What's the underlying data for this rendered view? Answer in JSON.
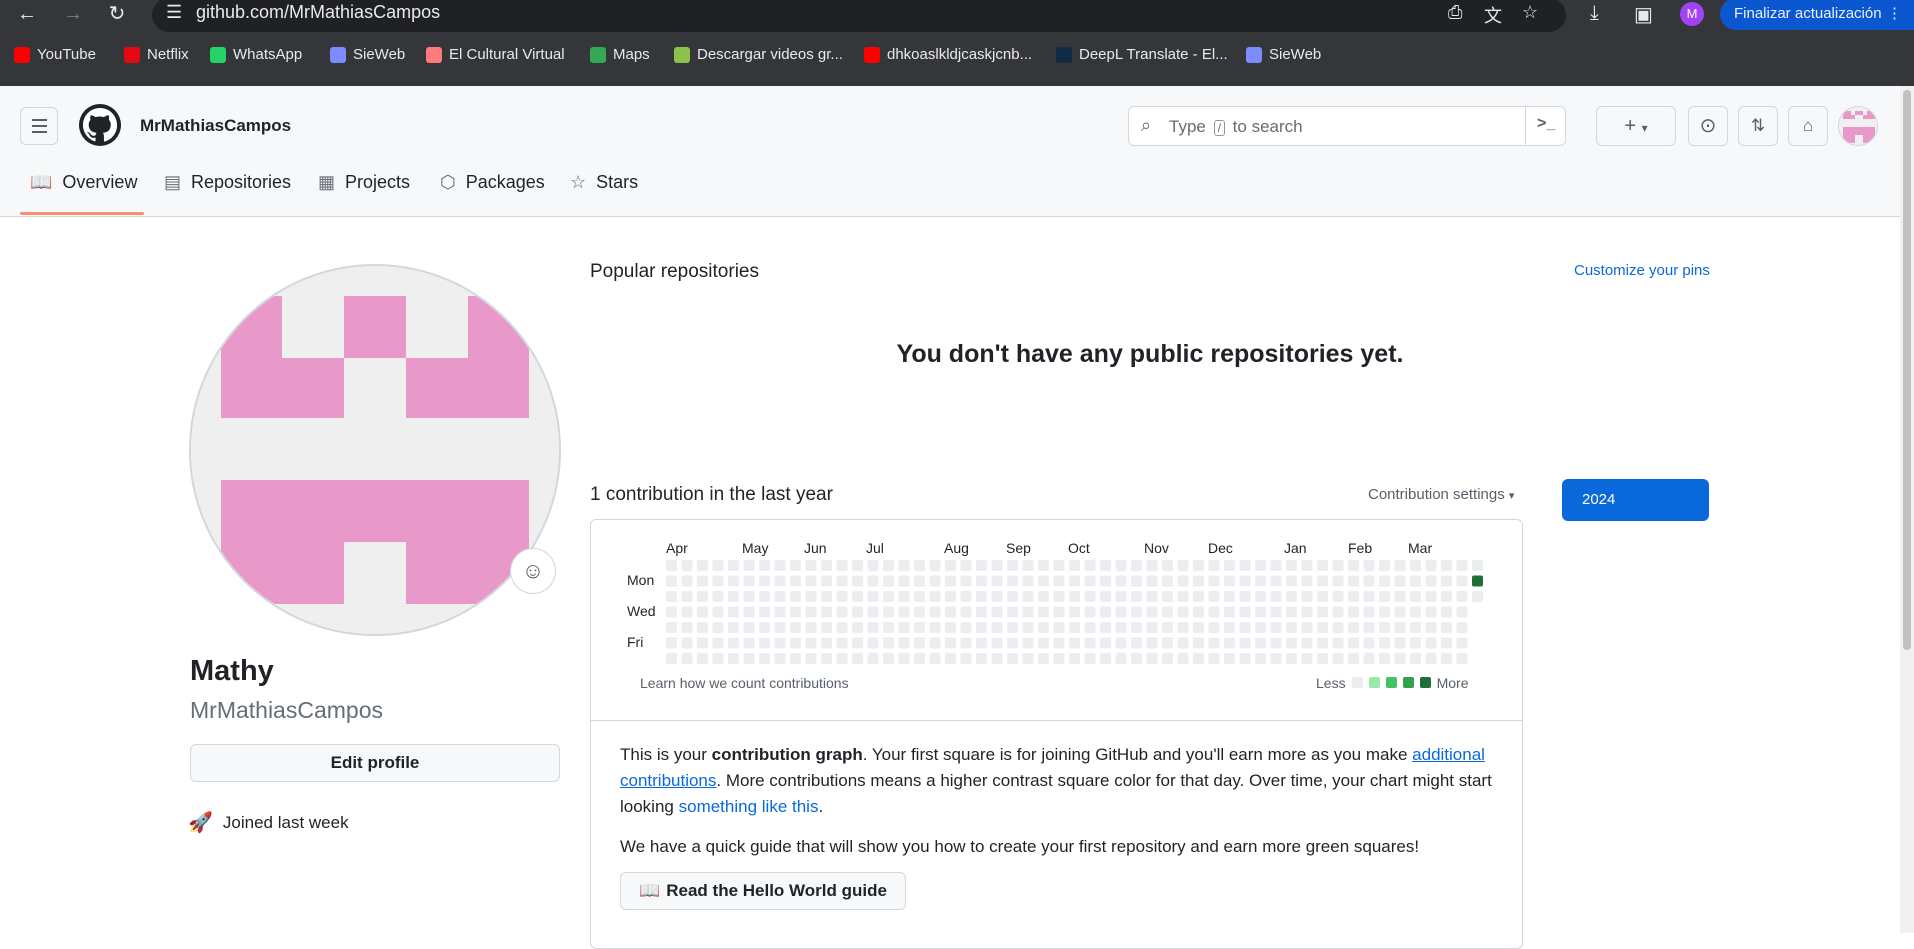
{
  "browser": {
    "url": "github.com/MrMathiasCampos",
    "profile_initial": "M",
    "update_label": "Finalizar actualización",
    "bookmarks": [
      {
        "label": "YouTube",
        "icon": "youtube-icon",
        "color": "#ff0000"
      },
      {
        "label": "Netflix",
        "icon": "netflix-icon",
        "color": "#e50914"
      },
      {
        "label": "WhatsApp",
        "icon": "whatsapp-icon",
        "color": "#25d366"
      },
      {
        "label": "SieWeb",
        "icon": "sieweb-icon",
        "color": "#7b8cff"
      },
      {
        "label": "El Cultural Virtual",
        "icon": "cultural-icon",
        "color": "#ff7a7a"
      },
      {
        "label": "Maps",
        "icon": "maps-icon",
        "color": "#34a853"
      },
      {
        "label": "Descargar videos gr...",
        "icon": "download-arrow-icon",
        "color": "#8bc34a"
      },
      {
        "label": "dhkoaslkldjcaskjcnb...",
        "icon": "youtube-icon",
        "color": "#ff0000"
      },
      {
        "label": "DeepL Translate - El...",
        "icon": "deepl-icon",
        "color": "#0f2b46"
      },
      {
        "label": "SieWeb",
        "icon": "sieweb-icon",
        "color": "#7b8cff"
      }
    ]
  },
  "header": {
    "username": "MrMathiasCampos",
    "search_prefix": "Type",
    "search_key": "/",
    "search_suffix": "to search"
  },
  "tabs": [
    {
      "label": "Overview",
      "icon": "book-icon",
      "active": true
    },
    {
      "label": "Repositories",
      "icon": "repo-icon",
      "active": false
    },
    {
      "label": "Projects",
      "icon": "table-icon",
      "active": false
    },
    {
      "label": "Packages",
      "icon": "package-icon",
      "active": false
    },
    {
      "label": "Stars",
      "icon": "star-icon",
      "active": false
    }
  ],
  "profile": {
    "name": "Mathy",
    "login": "MrMathiasCampos",
    "edit_label": "Edit profile",
    "joined": "Joined last week"
  },
  "popular": {
    "title": "Popular repositories",
    "customize": "Customize your pins",
    "empty": "You don't have any public repositories yet."
  },
  "contributions": {
    "title": "1 contribution in the last year",
    "settings": "Contribution settings",
    "year": "2024",
    "months": [
      "Apr",
      "May",
      "Jun",
      "Jul",
      "Aug",
      "Sep",
      "Oct",
      "Nov",
      "Dec",
      "Jan",
      "Feb",
      "Mar"
    ],
    "days": [
      "Mon",
      "Wed",
      "Fri"
    ],
    "learn": "Learn how we count contributions",
    "less": "Less",
    "more": "More",
    "level_colors": [
      "#ebedf0",
      "#9be9a8",
      "#40c463",
      "#30a14e",
      "#216e39"
    ],
    "weeks": 53,
    "last_week_days": 3,
    "contribution": {
      "week": 52,
      "day": 1,
      "level": 4
    }
  },
  "info": {
    "p1_a": "This is your ",
    "p1_b": "contribution graph",
    "p1_c": ". Your first square is for joining GitHub and you'll earn more as you make ",
    "p1_link1": "additional contributions",
    "p1_d": ". More contributions means a higher contrast square color for that day. Over time, your chart might start looking ",
    "p1_link2": "something like this",
    "p1_e": ".",
    "p2": "We have a quick guide that will show you how to create your first repository and earn more green squares!",
    "guide_label": "Read the Hello World guide"
  }
}
